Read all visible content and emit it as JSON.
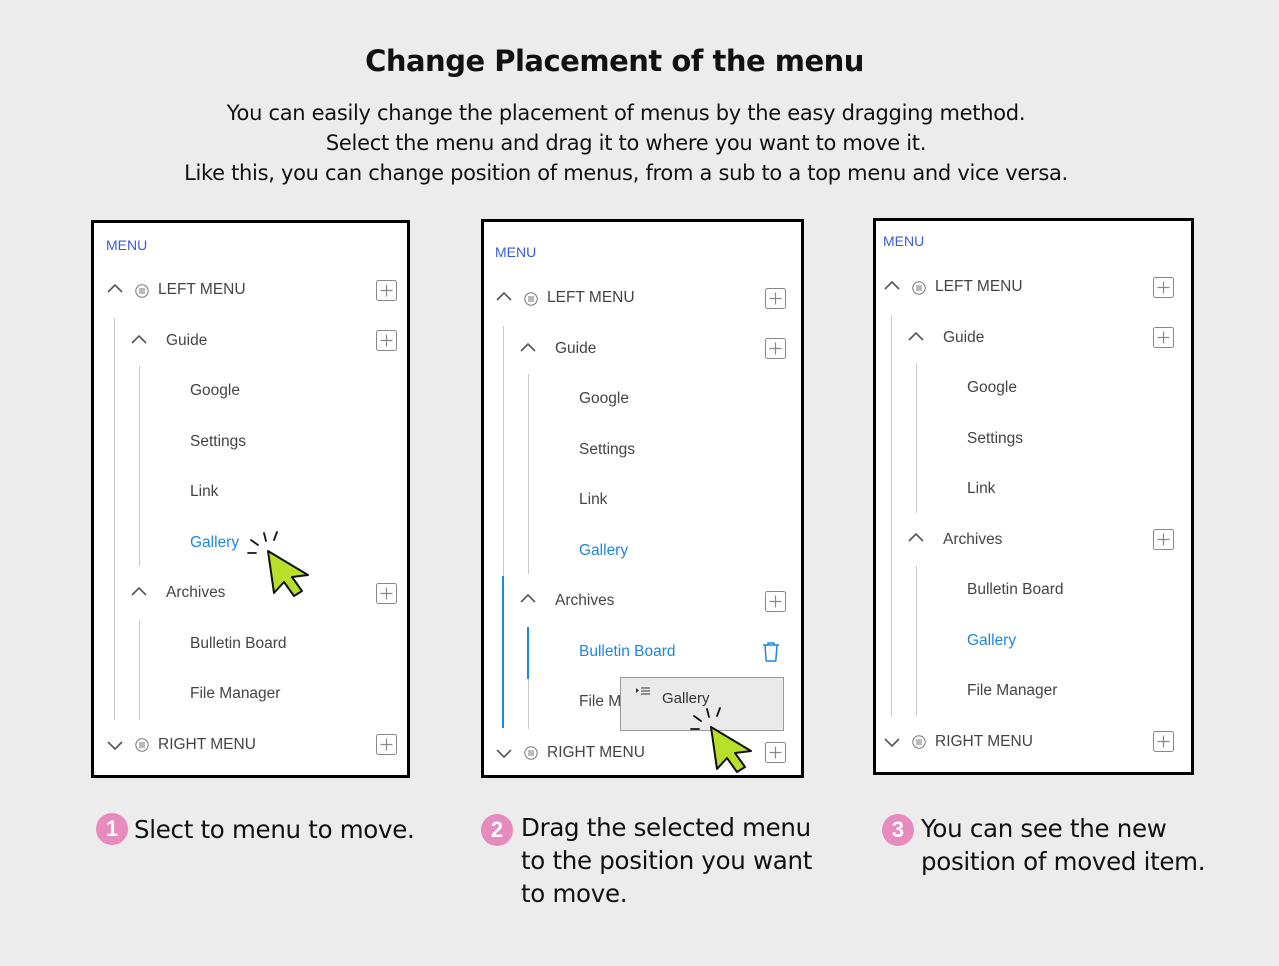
{
  "title": "Change Placement of the menu",
  "description": [
    "You can easily change the placement of menus by the easy dragging method.",
    "Select the menu and drag it to where you want to move it.",
    "Like this, you can change position of menus, from a sub to a top menu and vice versa."
  ],
  "panels": [
    {
      "menu_label": "MENU",
      "left_menu": "LEFT MENU",
      "guide": "Guide",
      "google": "Google",
      "settings": "Settings",
      "link": "Link",
      "gallery": "Gallery",
      "archives": "Archives",
      "bulletin": "Bulletin Board",
      "file_manager": "File Manager",
      "right_menu": "RIGHT MENU"
    },
    {
      "menu_label": "MENU",
      "left_menu": "LEFT MENU",
      "guide": "Guide",
      "google": "Google",
      "settings": "Settings",
      "link": "Link",
      "gallery": "Gallery",
      "archives": "Archives",
      "bulletin": "Bulletin Board",
      "file_manager": "File Ma",
      "right_menu": "RIGHT MENU",
      "drag_item": "Gallery"
    },
    {
      "menu_label": "MENU",
      "left_menu": "LEFT MENU",
      "guide": "Guide",
      "google": "Google",
      "settings": "Settings",
      "link": "Link",
      "archives": "Archives",
      "bulletin": "Bulletin Board",
      "gallery": "Gallery",
      "file_manager": "File Manager",
      "right_menu": "RIGHT MENU"
    }
  ],
  "steps": [
    {
      "number": "1",
      "lines": [
        "Slect to menu to move."
      ]
    },
    {
      "number": "2",
      "lines": [
        "Drag the selected menu",
        "to the position you want",
        "to move."
      ]
    },
    {
      "number": "3",
      "lines": [
        "You can see the new",
        "position of moved item."
      ]
    }
  ],
  "colors": {
    "accent": "#1f86e0",
    "menu_label": "#3b5bd6",
    "badge": "#e78bbf",
    "cursor": "#b8e02a",
    "background": "#ececec"
  },
  "icons": [
    "chevron-up-icon",
    "chevron-down-icon",
    "menu-lines-icon",
    "plus-box-icon",
    "trash-icon",
    "cursor-arrow-icon",
    "drag-handle-icon"
  ]
}
